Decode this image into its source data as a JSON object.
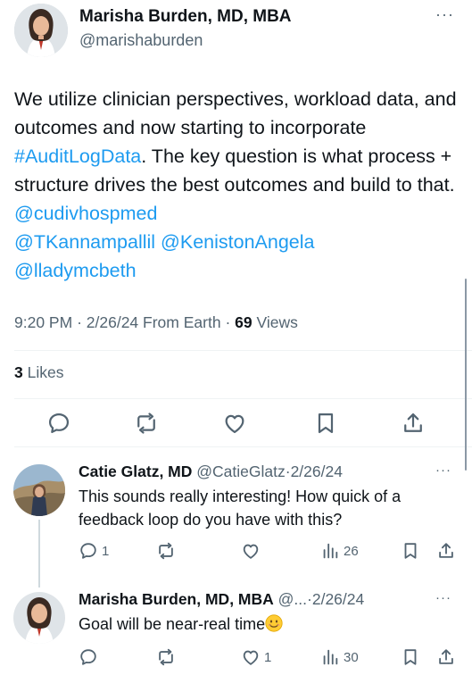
{
  "main_tweet": {
    "author_name": "Marisha Burden, MD, MBA",
    "handle": "@marishaburden",
    "more": "···",
    "body_parts": [
      {
        "text": "We utilize clinician perspectives, workload data, and outcomes and now starting to incorporate ",
        "link": false
      },
      {
        "text": "#AuditLogData",
        "link": true
      },
      {
        "text": ". The key question is what process + structure drives the best outcomes and build to that. ",
        "link": false
      },
      {
        "text": "@cudivhospmed",
        "link": true
      },
      {
        "text": " ",
        "link": false
      },
      {
        "text": "@TKannampallil",
        "link": true
      },
      {
        "text": " ",
        "link": false
      },
      {
        "text": "@KenistonAngela",
        "link": true
      },
      {
        "text": " ",
        "link": false
      },
      {
        "text": "@lladymcbeth",
        "link": true
      }
    ],
    "time": "9:20 PM",
    "date": "2/26/24",
    "source": "From Earth",
    "separator": "·",
    "views_count": "69",
    "views_label": "Views",
    "likes_count": "3",
    "likes_label": "Likes"
  },
  "replies": [
    {
      "author_name": "Catie Glatz, MD",
      "handle": "@CatieGlatz",
      "date": "2/26/24",
      "separator": "·",
      "text": "This sounds really interesting! How quick of a feedback loop do you have with this?",
      "more": "···",
      "reply_count": "1",
      "repost_count": "",
      "like_count": "",
      "views_count": "26"
    },
    {
      "author_name": "Marisha Burden, MD, MBA",
      "handle": "@...",
      "date": "2/26/24",
      "separator": "·",
      "text": "Goal will be near-real time",
      "more": "···",
      "reply_count": "",
      "repost_count": "",
      "like_count": "1",
      "views_count": "30"
    }
  ],
  "colors": {
    "link": "#1d9bf0",
    "muted": "#536471",
    "text": "#0f1419",
    "divider": "#eff3f4"
  },
  "icons": [
    "reply-icon",
    "repost-icon",
    "like-icon",
    "bookmark-icon",
    "share-icon",
    "views-icon",
    "more-icon",
    "smile-emoji"
  ]
}
